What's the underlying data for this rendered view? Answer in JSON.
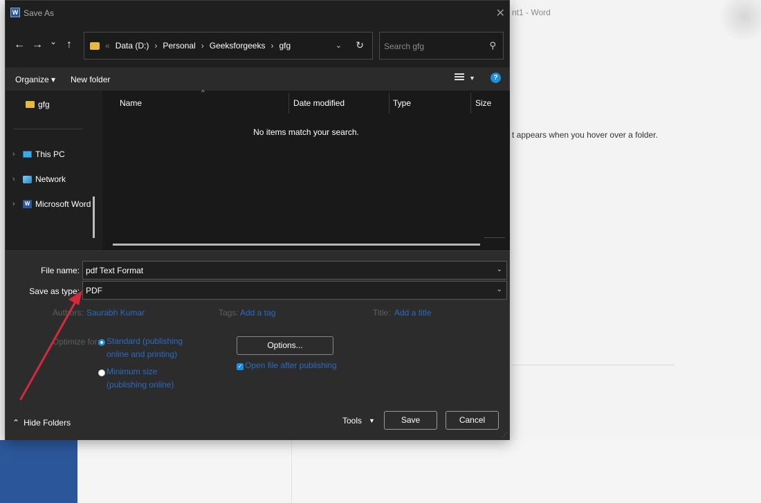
{
  "background": {
    "title": "nt1  -  Word",
    "hint_text": "t appears when you hover over a folder."
  },
  "dialog": {
    "title": "Save As",
    "app_icon_letter": "W",
    "close_glyph": "✕"
  },
  "nav": {
    "back": "←",
    "forward": "→",
    "recent": "⌄",
    "up": "↑",
    "breadcrumb": [
      "Data (D:)",
      "Personal",
      "Geeksforgeeks",
      "gfg"
    ],
    "breadcrumb_overflow": "«",
    "separator": "›",
    "dropdown_glyph": "⌄",
    "refresh_glyph": "↻"
  },
  "search": {
    "placeholder": "Search gfg",
    "icon": "search-icon"
  },
  "toolbar": {
    "organize": "Organize ▾",
    "new_folder": "New folder",
    "help": "?"
  },
  "nav_pane": {
    "current_folder": "gfg",
    "items": [
      {
        "label": "This PC",
        "icon": "computer-icon"
      },
      {
        "label": "Network",
        "icon": "network-icon"
      },
      {
        "label": "Microsoft Word",
        "icon": "word-icon"
      }
    ],
    "chevron": "›"
  },
  "file_list": {
    "columns": [
      "Name",
      "Date modified",
      "Type",
      "Size"
    ],
    "sort_indicator": "^",
    "empty_message": "No items match your search."
  },
  "form": {
    "file_name_label": "File name:",
    "file_name_value": "pdf Text Format",
    "save_type_label": "Save as type:",
    "save_type_value": "PDF",
    "authors_label": "Authors:",
    "authors_value": "Saurabh Kumar",
    "tags_label": "Tags:",
    "tags_value": "Add a tag",
    "title_label": "Title:",
    "title_value": "Add a title",
    "optimize_label": "Optimize for:",
    "optimize_options": [
      {
        "line1": "Standard (publishing",
        "line2": "online and printing)",
        "selected": true
      },
      {
        "line1": "Minimum size",
        "line2": "(publishing online)",
        "selected": false
      }
    ],
    "options_button": "Options...",
    "open_after_publishing": "Open file after publishing",
    "open_after_checked": true
  },
  "footer": {
    "hide_folders": "Hide Folders",
    "tools": "Tools",
    "save": "Save",
    "cancel": "Cancel"
  },
  "colors": {
    "accent": "#1e8fdc",
    "link": "#2b6bc0",
    "annotation_arrow": "#d62a3c",
    "word_blue": "#2b579a",
    "folder_yellow": "#e7b93f"
  }
}
